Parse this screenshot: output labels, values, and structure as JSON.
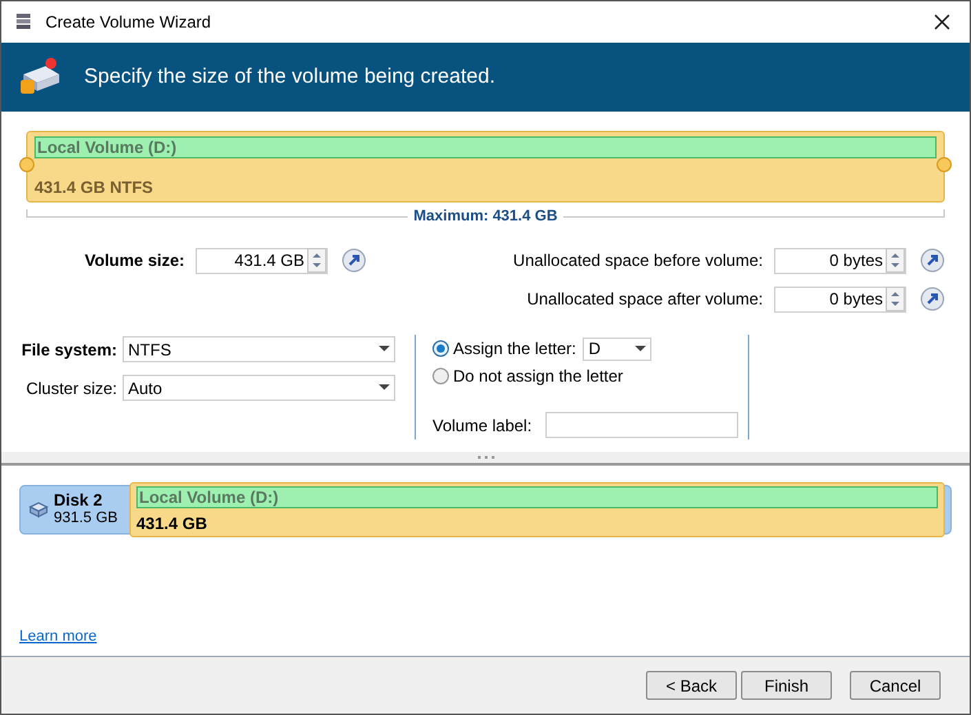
{
  "window": {
    "title": "Create Volume Wizard"
  },
  "header": {
    "text": "Specify the size of the volume being created."
  },
  "volume_bar": {
    "name": "Local Volume (D:)",
    "info": "431.4 GB NTFS",
    "maximum": "Maximum: 431.4 GB"
  },
  "size": {
    "label": "Volume size:",
    "value": "431.4 GB"
  },
  "unallocated_before": {
    "label": "Unallocated space before volume:",
    "value": "0 bytes"
  },
  "unallocated_after": {
    "label": "Unallocated space after volume:",
    "value": "0 bytes"
  },
  "file_system": {
    "label": "File system:",
    "value": "NTFS"
  },
  "cluster_size": {
    "label": "Cluster size:",
    "value": "Auto"
  },
  "letter_options": [
    {
      "label": "Assign the letter:",
      "selected": true,
      "kind": "letter",
      "value": "D"
    },
    {
      "label": "Do not assign the letter",
      "selected": false,
      "kind": "plain"
    }
  ],
  "volume_label": {
    "label": "Volume label:"
  },
  "disk_map": {
    "disk": "Disk 2",
    "disk_size": "931.5 GB",
    "volume": "Local Volume (D:)",
    "volume_size": "431.4 GB"
  },
  "learn_more": "Learn more",
  "buttons": [
    "< Back",
    "Finish",
    "Cancel"
  ]
}
